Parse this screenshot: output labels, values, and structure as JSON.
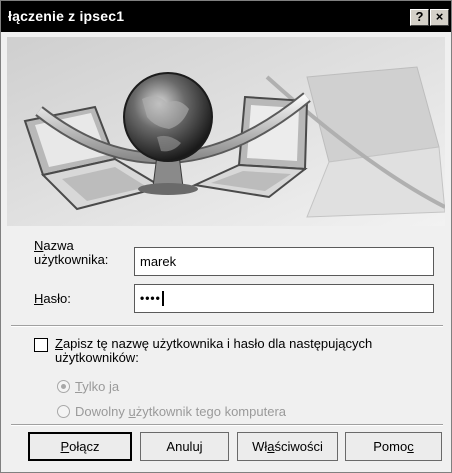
{
  "window": {
    "title": "łączenie z ipsec1",
    "help_label": "?",
    "close_label": "×"
  },
  "form": {
    "username_label_underlined": "N",
    "username_label_rest": "azwa",
    "username_label_line2": "użytkownika:",
    "username_value": "marek",
    "password_label_underlined": "H",
    "password_label_rest": "asło:",
    "password_value": "••••"
  },
  "save": {
    "label_underlined": "Z",
    "label_rest": "apisz tę nazwę użytkownika i hasło dla następujących",
    "label_line2": "użytkowników:",
    "checked": false,
    "option_me_underlined": "T",
    "option_me_rest": "ylko ja",
    "option_any_prefix": "Dowolny ",
    "option_any_underlined": "u",
    "option_any_rest": "żytkownik tego komputera",
    "selected_option": "option_me"
  },
  "buttons": {
    "connect_prefix": "",
    "connect_underlined": "P",
    "connect_rest": "ołącz",
    "cancel": "Anuluj",
    "properties_prefix": "Wł",
    "properties_underlined": "a",
    "properties_rest": "ściwości",
    "help_prefix": "Pomo",
    "help_underlined": "c",
    "help_rest": ""
  },
  "icons": {
    "banner": "network-globe-laptops-illustration",
    "help": "question-mark-icon",
    "close": "close-icon"
  }
}
